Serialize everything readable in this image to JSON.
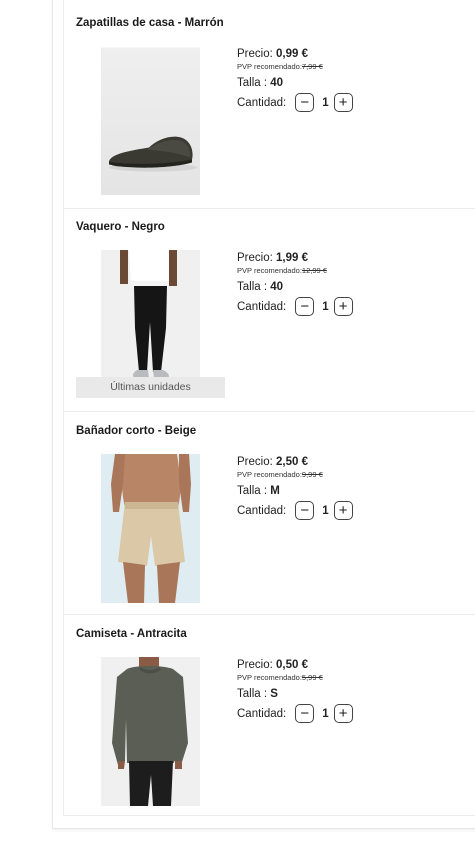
{
  "labels": {
    "price": "Precio:",
    "rrp": "PVP recomendado:",
    "size": "Talla :",
    "quantity": "Cantidad:"
  },
  "products": [
    {
      "title": "Zapatillas de casa - Marrón",
      "price": "0,99 €",
      "rrp": "7,99 €",
      "size": "40",
      "quantity": "1",
      "image": "brown-slipper"
    },
    {
      "title": "Vaquero - Negro",
      "price": "1,99 €",
      "rrp": "12,99 €",
      "size": "40",
      "quantity": "1",
      "image": "black-jeans-model",
      "badge": "Últimas unidades"
    },
    {
      "title": "Bañador corto - Beige",
      "price": "2,50 €",
      "rrp": "9,99 €",
      "size": "M",
      "quantity": "1",
      "image": "beige-swim-shorts-model"
    },
    {
      "title": "Camiseta - Antracita",
      "price": "0,50 €",
      "rrp": "5,99 €",
      "size": "S",
      "quantity": "1",
      "image": "anthracite-long-sleeve-tshirt-model"
    }
  ],
  "icons": {
    "decrease": "minus-icon",
    "increase": "plus-icon"
  }
}
